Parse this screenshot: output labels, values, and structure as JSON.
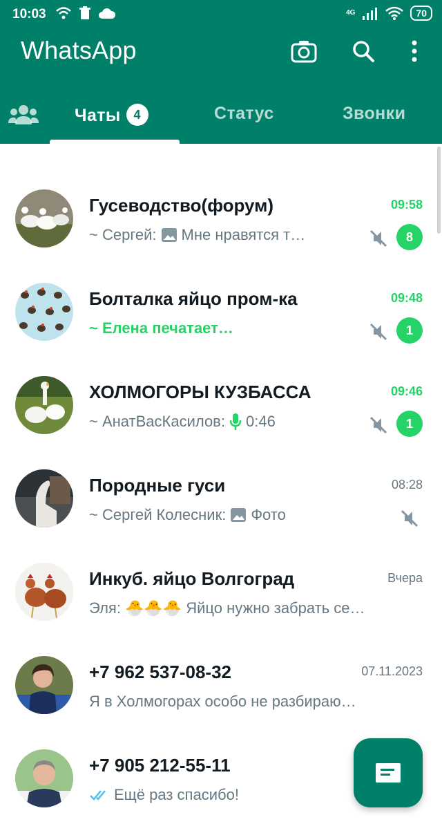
{
  "status_bar": {
    "time": "10:03",
    "battery": "70",
    "network": "4G"
  },
  "app": {
    "title": "WhatsApp"
  },
  "tabs": [
    {
      "label": "Чаты",
      "badge": "4",
      "active": true
    },
    {
      "label": "Статус",
      "active": false
    },
    {
      "label": "Звонки",
      "active": false
    }
  ],
  "chats": [
    {
      "name": "Гусеводство(форум)",
      "time": "09:58",
      "time_unread": true,
      "sender": "~ Сергей:",
      "preview": "Мне нравятся т…",
      "preview_icon": "image-icon",
      "muted": true,
      "unread": "8"
    },
    {
      "name": "Болталка яйцо пром-ка",
      "time": "09:48",
      "time_unread": true,
      "preview": "~ Елена печатает…",
      "typing": true,
      "muted": true,
      "unread": "1"
    },
    {
      "name": "ХОЛМОГОРЫ КУЗБАССА",
      "time": "09:46",
      "time_unread": true,
      "sender": "~ АнатВасКасилов:",
      "preview": "0:46",
      "preview_icon": "mic-icon",
      "muted": true,
      "unread": "1"
    },
    {
      "name": "Породные гуси",
      "time": "08:28",
      "time_unread": false,
      "sender": "~ Сергей Колесник:",
      "preview": "Фото",
      "preview_icon": "image-icon",
      "muted": true
    },
    {
      "name": "Инкуб. яйцо Волгоград",
      "time": "Вчера",
      "time_unread": false,
      "sender": "Эля:",
      "preview": "🐣🐣🐣 Яйцо нужно забрать се…",
      "muted": false
    },
    {
      "name": "+7 962 537-08-32",
      "time": "07.11.2023",
      "time_unread": false,
      "preview": "Я в Холмогорах особо не разбираю…",
      "muted": false
    },
    {
      "name": "+7 905 212-55-11",
      "time": "",
      "time_unread": false,
      "preview": "Ещё раз спасибо!",
      "preview_icon": "double-check-icon",
      "muted": false
    }
  ],
  "colors": {
    "brand": "#008069",
    "unread": "#25d366",
    "secondary": "#667781"
  }
}
